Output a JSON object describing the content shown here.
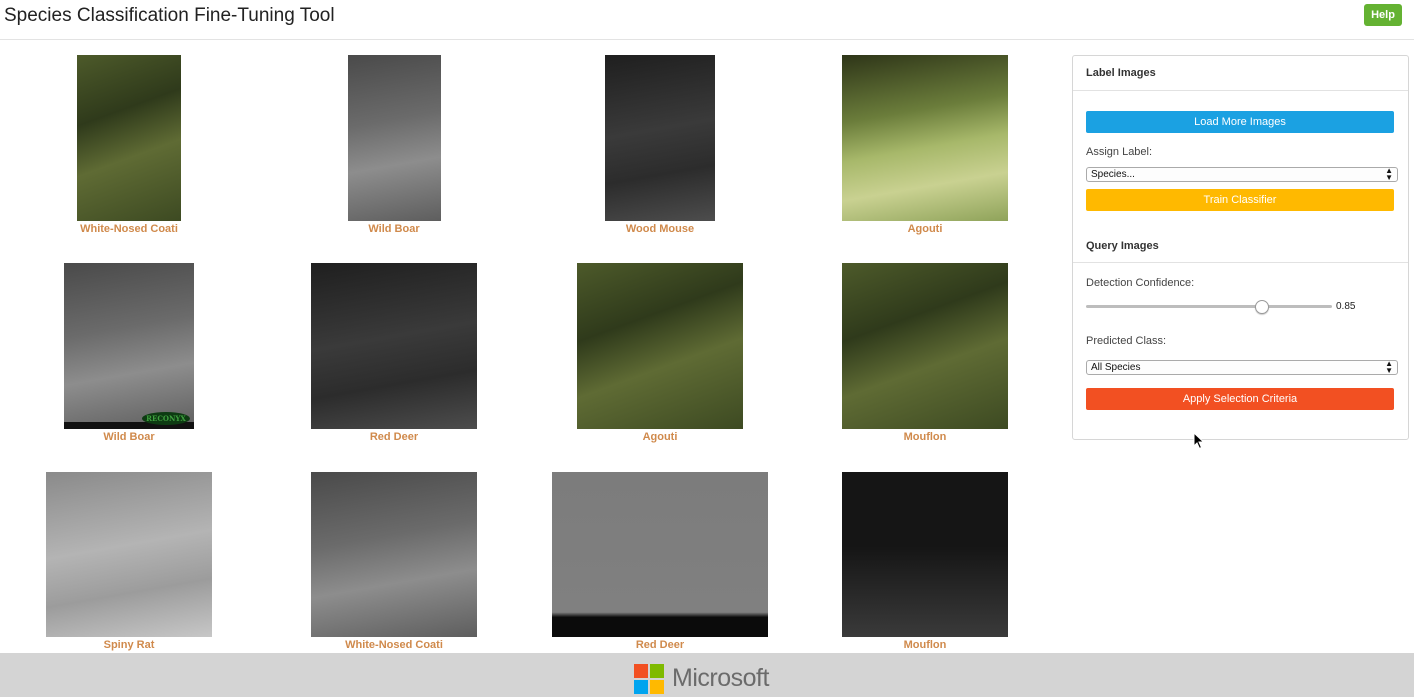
{
  "app": {
    "title": "Species Classification Fine-Tuning Tool",
    "help_label": "Help"
  },
  "gallery": [
    {
      "caption": "White-Nosed Coati",
      "tone": "color-forest"
    },
    {
      "caption": "Wild Boar",
      "tone": "gray"
    },
    {
      "caption": "Wood Mouse",
      "tone": "dark-gray"
    },
    {
      "caption": "Agouti",
      "tone": "color-bright"
    },
    {
      "caption": "Wild Boar",
      "tone": "gray",
      "watermark": "RECONYX"
    },
    {
      "caption": "Red Deer",
      "tone": "dark-gray"
    },
    {
      "caption": "Agouti",
      "tone": "color-forest"
    },
    {
      "caption": "Mouflon",
      "tone": "color-forest"
    },
    {
      "caption": "Spiny Rat",
      "tone": "light-gray"
    },
    {
      "caption": "White-Nosed Coati",
      "tone": "gray"
    },
    {
      "caption": "Red Deer",
      "tone": "mid-gray"
    },
    {
      "caption": "Mouflon",
      "tone": "black"
    }
  ],
  "panel": {
    "heading": "Label Images",
    "load_more_label": "Load More Images",
    "assign_label": "Assign Label:",
    "species_select": "Species...",
    "train_label": "Train Classifier",
    "query_heading": "Query Images",
    "confidence_label": "Detection Confidence:",
    "confidence_value": "0.85",
    "confidence": 0.71,
    "predicted_label": "Predicted Class:",
    "predicted_select": "All Species",
    "apply_label": "Apply Selection Criteria"
  },
  "colors": {
    "load_more": "#1ba1e2",
    "train": "#ffb900",
    "apply": "#f25022",
    "help": "#64b232",
    "caption": "#d08a4c"
  },
  "footer": {
    "brand": "Microsoft"
  }
}
